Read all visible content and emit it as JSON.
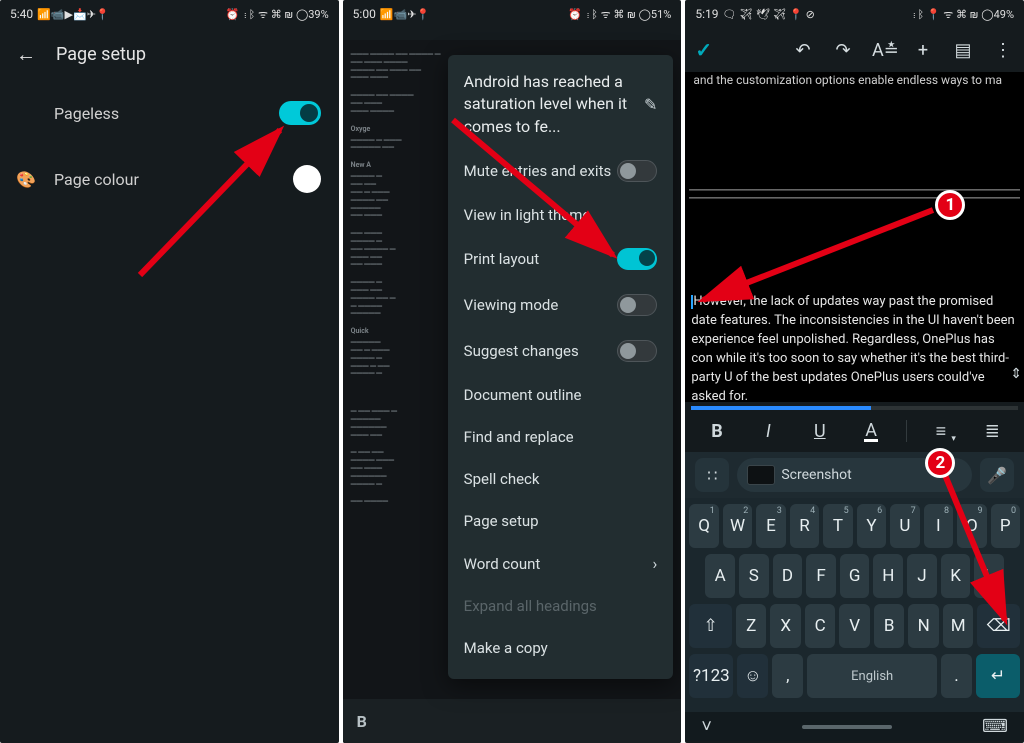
{
  "phone1": {
    "status": {
      "time": "5:40",
      "left_icons": "📶📹▶📩✈📍",
      "right_icons": "⏰ ⋮ᛒ ᯤ ⌘ ₪",
      "battery": "◯39%"
    },
    "title": "Page setup",
    "rows": {
      "pageless": {
        "label": "Pageless",
        "toggle_on": true
      },
      "page_colour": {
        "label": "Page colour",
        "leading": "🎨"
      }
    }
  },
  "phone2": {
    "status": {
      "time": "5:00",
      "left_icons": "📶📹✈📍",
      "right_icons": "⏰ ⋮ᛒ ᯤ ⌘ ₪",
      "battery": "◯51%"
    },
    "doc_title": "Android has reached a saturation level when it comes to fe...",
    "menu": {
      "mute": {
        "label": "Mute entries and exits",
        "on": false
      },
      "light": {
        "label": "View in light theme"
      },
      "print": {
        "label": "Print layout",
        "on": true
      },
      "viewing": {
        "label": "Viewing mode",
        "on": false
      },
      "suggest": {
        "label": "Suggest changes",
        "on": false
      },
      "outline": {
        "label": "Document outline"
      },
      "find": {
        "label": "Find and replace"
      },
      "spell": {
        "label": "Spell check"
      },
      "pagesetup": {
        "label": "Page setup"
      },
      "wordcount": {
        "label": "Word count"
      },
      "expand": {
        "label": "Expand all headings"
      },
      "makecopy": {
        "label": "Make a copy"
      }
    },
    "blur": {
      "h1": "Oxyge",
      "h2": "New A",
      "h3": "Quick"
    }
  },
  "phone3": {
    "status": {
      "time": "5:19",
      "left_icons": "🗨 ✈ 🕊 ✈ 📍 ⊘",
      "right_icons": "⋮ᛒ 📍 ᯤ ⌘ ₪",
      "battery": "◯49%"
    },
    "toolbar": {
      "undo": "↶",
      "redo": "↷",
      "textfmt": "A≛",
      "add": "+",
      "comment": "▤",
      "more": "⋮"
    },
    "snippet_top": "and the customization options enable endless ways to ma",
    "para": "However, the lack of updates way past the promised date features. The inconsistencies in the UI haven't been experience feel unpolished. Regardless, OnePlus has con while it's too soon to say whether it's the best third-party U of the best updates OnePlus users could've asked for.",
    "fmt": {
      "bold": "B",
      "italic": "I",
      "underline": "U",
      "color": "A",
      "align": "≡",
      "list": "≣"
    },
    "suggestion": {
      "chip": "Screenshot",
      "menu": "∷",
      "mic": "🎤"
    },
    "keyboard": {
      "row1": [
        "Q",
        "W",
        "E",
        "R",
        "T",
        "Y",
        "U",
        "I",
        "O",
        "P"
      ],
      "row1_nums": [
        "1",
        "2",
        "3",
        "4",
        "5",
        "6",
        "7",
        "8",
        "9",
        "0"
      ],
      "row2": [
        "A",
        "S",
        "D",
        "F",
        "G",
        "H",
        "J",
        "K",
        "L"
      ],
      "row3_shift": "⇧",
      "row3": [
        "Z",
        "X",
        "C",
        "V",
        "B",
        "N",
        "M"
      ],
      "row3_del": "⌫",
      "row4": {
        "sym": "?123",
        "emoji": "☺",
        "comma": ",",
        "space": "English",
        "period": ".",
        "enter": "↵"
      }
    },
    "badges": {
      "b1": "1",
      "b2": "2"
    }
  }
}
